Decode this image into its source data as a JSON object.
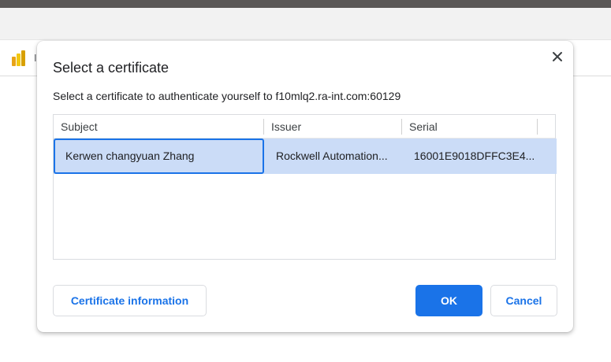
{
  "browser": {
    "bookmark_letter": "I"
  },
  "dialog": {
    "title": "Select a certificate",
    "subtitle": "Select a certificate to authenticate yourself to f10mlq2.ra-int.com:60129",
    "close_icon": "close-icon"
  },
  "table": {
    "columns": [
      "Subject",
      "Issuer",
      "Serial"
    ],
    "rows": [
      {
        "subject": "Kerwen changyuan Zhang",
        "issuer": "Rockwell Automation...",
        "serial": "16001E9018DFFC3E4..."
      }
    ]
  },
  "buttons": {
    "certificate_information": "Certificate information",
    "ok": "OK",
    "cancel": "Cancel"
  },
  "colors": {
    "accent": "#1a73e8",
    "selected_row": "#cbdcf7"
  }
}
